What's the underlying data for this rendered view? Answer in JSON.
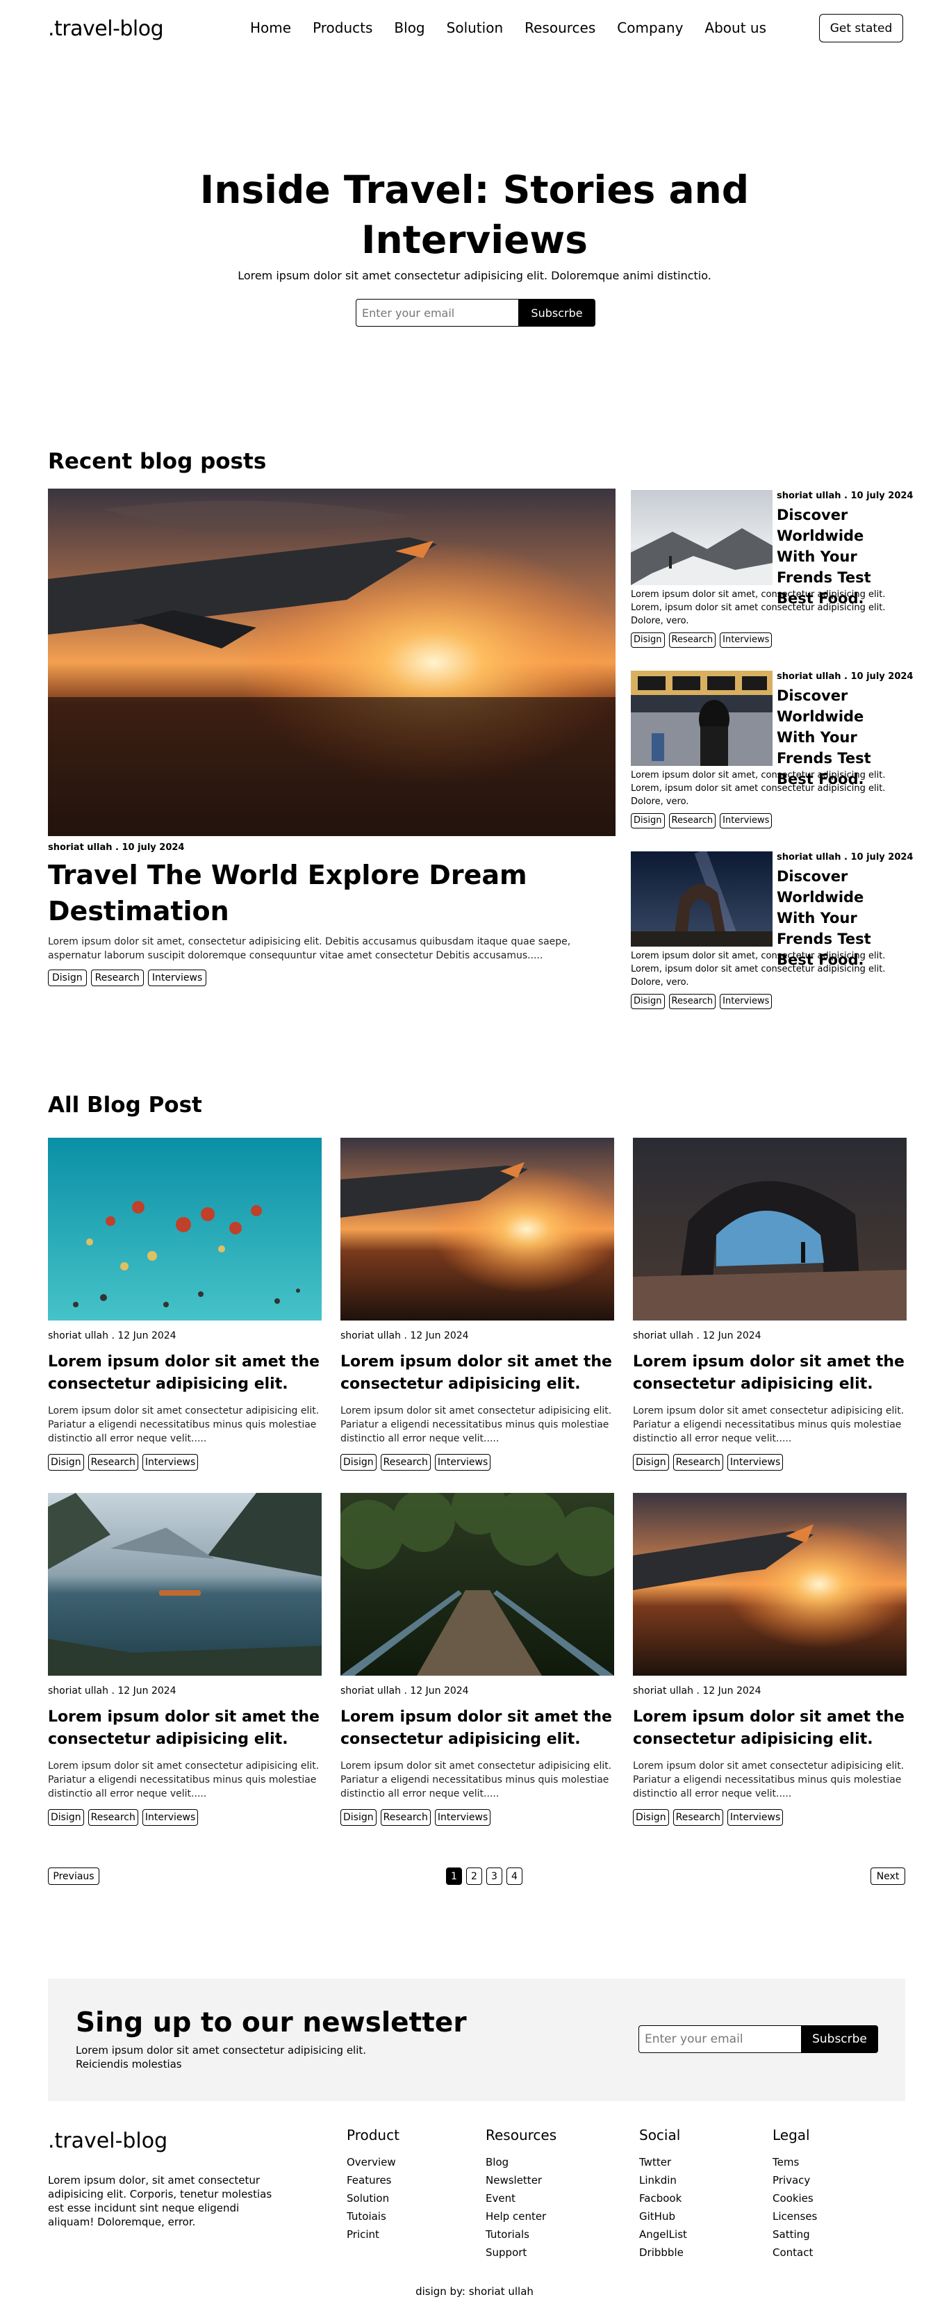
{
  "header": {
    "logo": ".travel-blog",
    "nav": [
      "Home",
      "Products",
      "Blog",
      "Solution",
      "Resources",
      "Company",
      "About us"
    ],
    "cta": "Get stated"
  },
  "hero": {
    "title": "Inside Travel: Stories and Interviews",
    "subtitle": "Lorem ipsum dolor sit amet consectetur adipisicing elit. Doloremque animi distinctio.",
    "email_placeholder": "Enter your email",
    "button": "Subscrbe"
  },
  "recent": {
    "heading": "Recent blog posts",
    "main": {
      "meta": "shoriat ullah . 10 july 2024",
      "title": "Travel The World Explore Dream Destimation",
      "excerpt": "Lorem ipsum dolor sit amet, consectetur adipisicing elit. Debitis accusamus quibusdam itaque quae saepe, aspernatur laborum suscipit doloremque consequuntur vitae amet consectetur Debitis accusamus.....",
      "tags": [
        "Disign",
        "Research",
        "Interviews"
      ]
    },
    "side": [
      {
        "meta": "shoriat ullah . 10 july 2024",
        "title": "Discover Worldwide With Your Frends Test Best Food.",
        "excerpt": "Lorem ipsum dolor sit amet, consectetur adipisicing elit. Lorem, ipsum dolor sit amet consectetur adipisicing elit. Dolore, vero.",
        "tags": [
          "Disign",
          "Research",
          "Interviews"
        ]
      },
      {
        "meta": "shoriat ullah . 10 july 2024",
        "title": "Discover Worldwide With Your Frends Test Best Food.",
        "excerpt": "Lorem ipsum dolor sit amet, consectetur adipisicing elit. Lorem, ipsum dolor sit amet consectetur adipisicing elit. Dolore, vero.",
        "tags": [
          "Disign",
          "Research",
          "Interviews"
        ]
      },
      {
        "meta": "shoriat ullah . 10 july 2024",
        "title": "Discover Worldwide With Your Frends Test Best Food.",
        "excerpt": "Lorem ipsum dolor sit amet, consectetur adipisicing elit. Lorem, ipsum dolor sit amet consectetur adipisicing elit. Dolore, vero.",
        "tags": [
          "Disign",
          "Research",
          "Interviews"
        ]
      }
    ]
  },
  "all": {
    "heading": "All Blog Post",
    "cards": [
      {
        "meta": "shoriat ullah . 12 Jun 2024",
        "title": "Lorem ipsum dolor sit amet the consectetur adipisicing elit.",
        "excerpt": "Lorem ipsum dolor sit amet consectetur adipisicing elit. Pariatur a eligendi necessitatibus minus quis molestiae distinctio all error neque velit.....",
        "tags": [
          "Disign",
          "Research",
          "Interviews"
        ]
      },
      {
        "meta": "shoriat ullah . 12 Jun 2024",
        "title": "Lorem ipsum dolor sit amet the consectetur adipisicing elit.",
        "excerpt": "Lorem ipsum dolor sit amet consectetur adipisicing elit. Pariatur a eligendi necessitatibus minus quis molestiae distinctio all error neque velit.....",
        "tags": [
          "Disign",
          "Research",
          "Interviews"
        ]
      },
      {
        "meta": "shoriat ullah . 12 Jun 2024",
        "title": "Lorem ipsum dolor sit amet the consectetur adipisicing elit.",
        "excerpt": "Lorem ipsum dolor sit amet consectetur adipisicing elit. Pariatur a eligendi necessitatibus minus quis molestiae distinctio all error neque velit.....",
        "tags": [
          "Disign",
          "Research",
          "Interviews"
        ]
      },
      {
        "meta": "shoriat ullah . 12 Jun 2024",
        "title": "Lorem ipsum dolor sit amet the consectetur adipisicing elit.",
        "excerpt": "Lorem ipsum dolor sit amet consectetur adipisicing elit. Pariatur a eligendi necessitatibus minus quis molestiae distinctio all error neque velit.....",
        "tags": [
          "Disign",
          "Research",
          "Interviews"
        ]
      },
      {
        "meta": "shoriat ullah . 12 Jun 2024",
        "title": "Lorem ipsum dolor sit amet the consectetur adipisicing elit.",
        "excerpt": "Lorem ipsum dolor sit amet consectetur adipisicing elit. Pariatur a eligendi necessitatibus minus quis molestiae distinctio all error neque velit.....",
        "tags": [
          "Disign",
          "Research",
          "Interviews"
        ]
      },
      {
        "meta": "shoriat ullah . 12 Jun 2024",
        "title": "Lorem ipsum dolor sit amet the consectetur adipisicing elit.",
        "excerpt": "Lorem ipsum dolor sit amet consectetur adipisicing elit. Pariatur a eligendi necessitatibus minus quis molestiae distinctio all error neque velit.....",
        "tags": [
          "Disign",
          "Research",
          "Interviews"
        ]
      }
    ]
  },
  "pagination": {
    "prev": "Previaus",
    "pages": [
      "1",
      "2",
      "3",
      "4"
    ],
    "current": "1",
    "next": "Next"
  },
  "newsletter": {
    "title": "Sing up to our newsletter",
    "subtitle": "Lorem ipsum dolor sit amet consectetur adipisicing elit. Reiciendis molestias",
    "email_placeholder": "Enter your email",
    "button": "Subscrbe"
  },
  "footer": {
    "logo": ".travel-blog",
    "desc": "Lorem ipsum dolor, sit amet consectetur adipisicing elit. Corporis, tenetur molestias est esse incidunt sint neque eligendi aliquam! Doloremque, error.",
    "columns": [
      {
        "title": "Product",
        "links": [
          "Overview",
          "Features",
          "Solution",
          "Tutoiais",
          "Pricint"
        ]
      },
      {
        "title": "Resources",
        "links": [
          "Blog",
          "Newsletter",
          "Event",
          "Help center",
          "Tutorials",
          "Support"
        ]
      },
      {
        "title": "Social",
        "links": [
          "Twtter",
          "Linkdin",
          "Facbook",
          "GitHub",
          "AngelList",
          "Dribbble"
        ]
      },
      {
        "title": "Legal",
        "links": [
          "Tems",
          "Privacy",
          "Cookies",
          "Licenses",
          "Satting",
          "Contact"
        ]
      }
    ],
    "credit": "disign by: shoriat ullah"
  }
}
